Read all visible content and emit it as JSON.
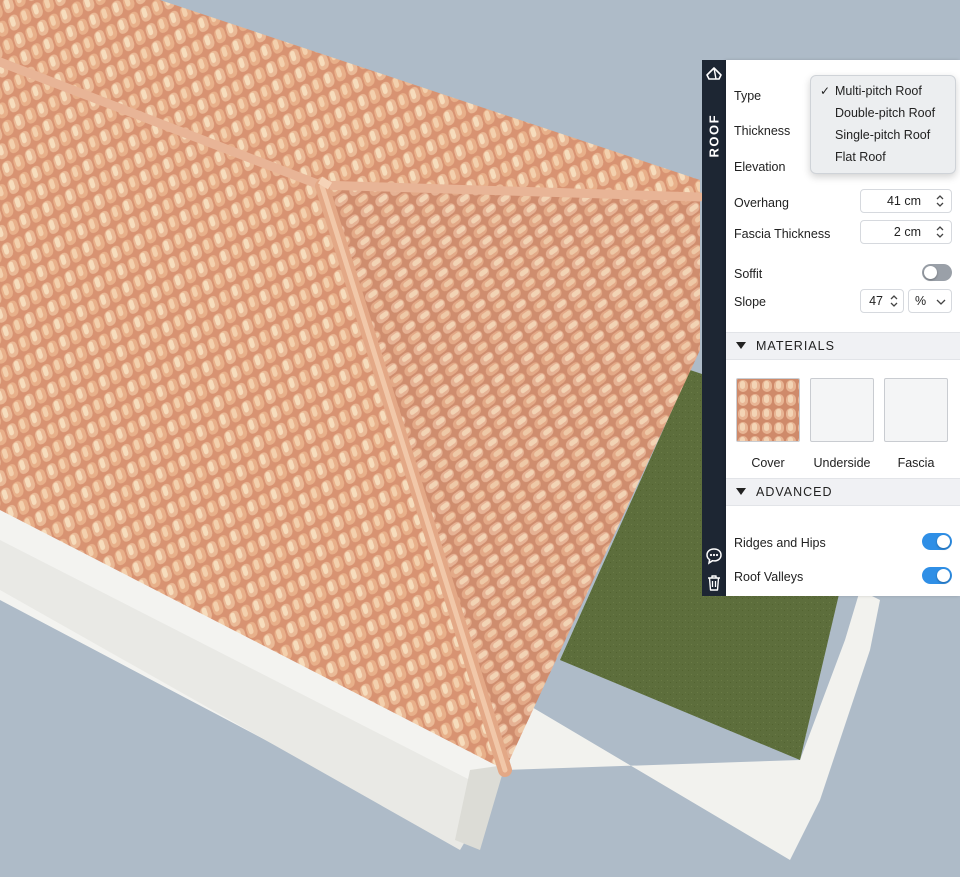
{
  "sidebar": {
    "title": "ROOF",
    "icons": [
      "roof-icon",
      "chat-icon",
      "trash-icon"
    ]
  },
  "properties": {
    "type_label": "Type",
    "thickness_label": "Thickness",
    "elevation_label": "Elevation",
    "overhang": {
      "label": "Overhang",
      "value": "41 cm"
    },
    "fascia_thickness": {
      "label": "Fascia Thickness",
      "value": "2 cm"
    },
    "soffit": {
      "label": "Soffit",
      "on": false
    },
    "slope": {
      "label": "Slope",
      "value": "47",
      "unit": "%"
    }
  },
  "type_dropdown": {
    "selected": "Multi-pitch Roof",
    "options": [
      "Multi-pitch Roof",
      "Double-pitch Roof",
      "Single-pitch Roof",
      "Flat Roof"
    ]
  },
  "materials": {
    "title": "MATERIALS",
    "items": [
      {
        "label": "Cover"
      },
      {
        "label": "Underside"
      },
      {
        "label": "Fascia"
      }
    ]
  },
  "advanced": {
    "title": "ADVANCED",
    "ridges_and_hips": {
      "label": "Ridges and Hips",
      "on": true
    },
    "roof_valleys": {
      "label": "Roof Valleys",
      "on": true
    }
  },
  "colors": {
    "accent": "#2f8fe6",
    "toggle_off": "#9aa0a8",
    "strip_bg": "#1d2633",
    "sky": "#aebbc8",
    "grass": "#5d6e3c"
  }
}
